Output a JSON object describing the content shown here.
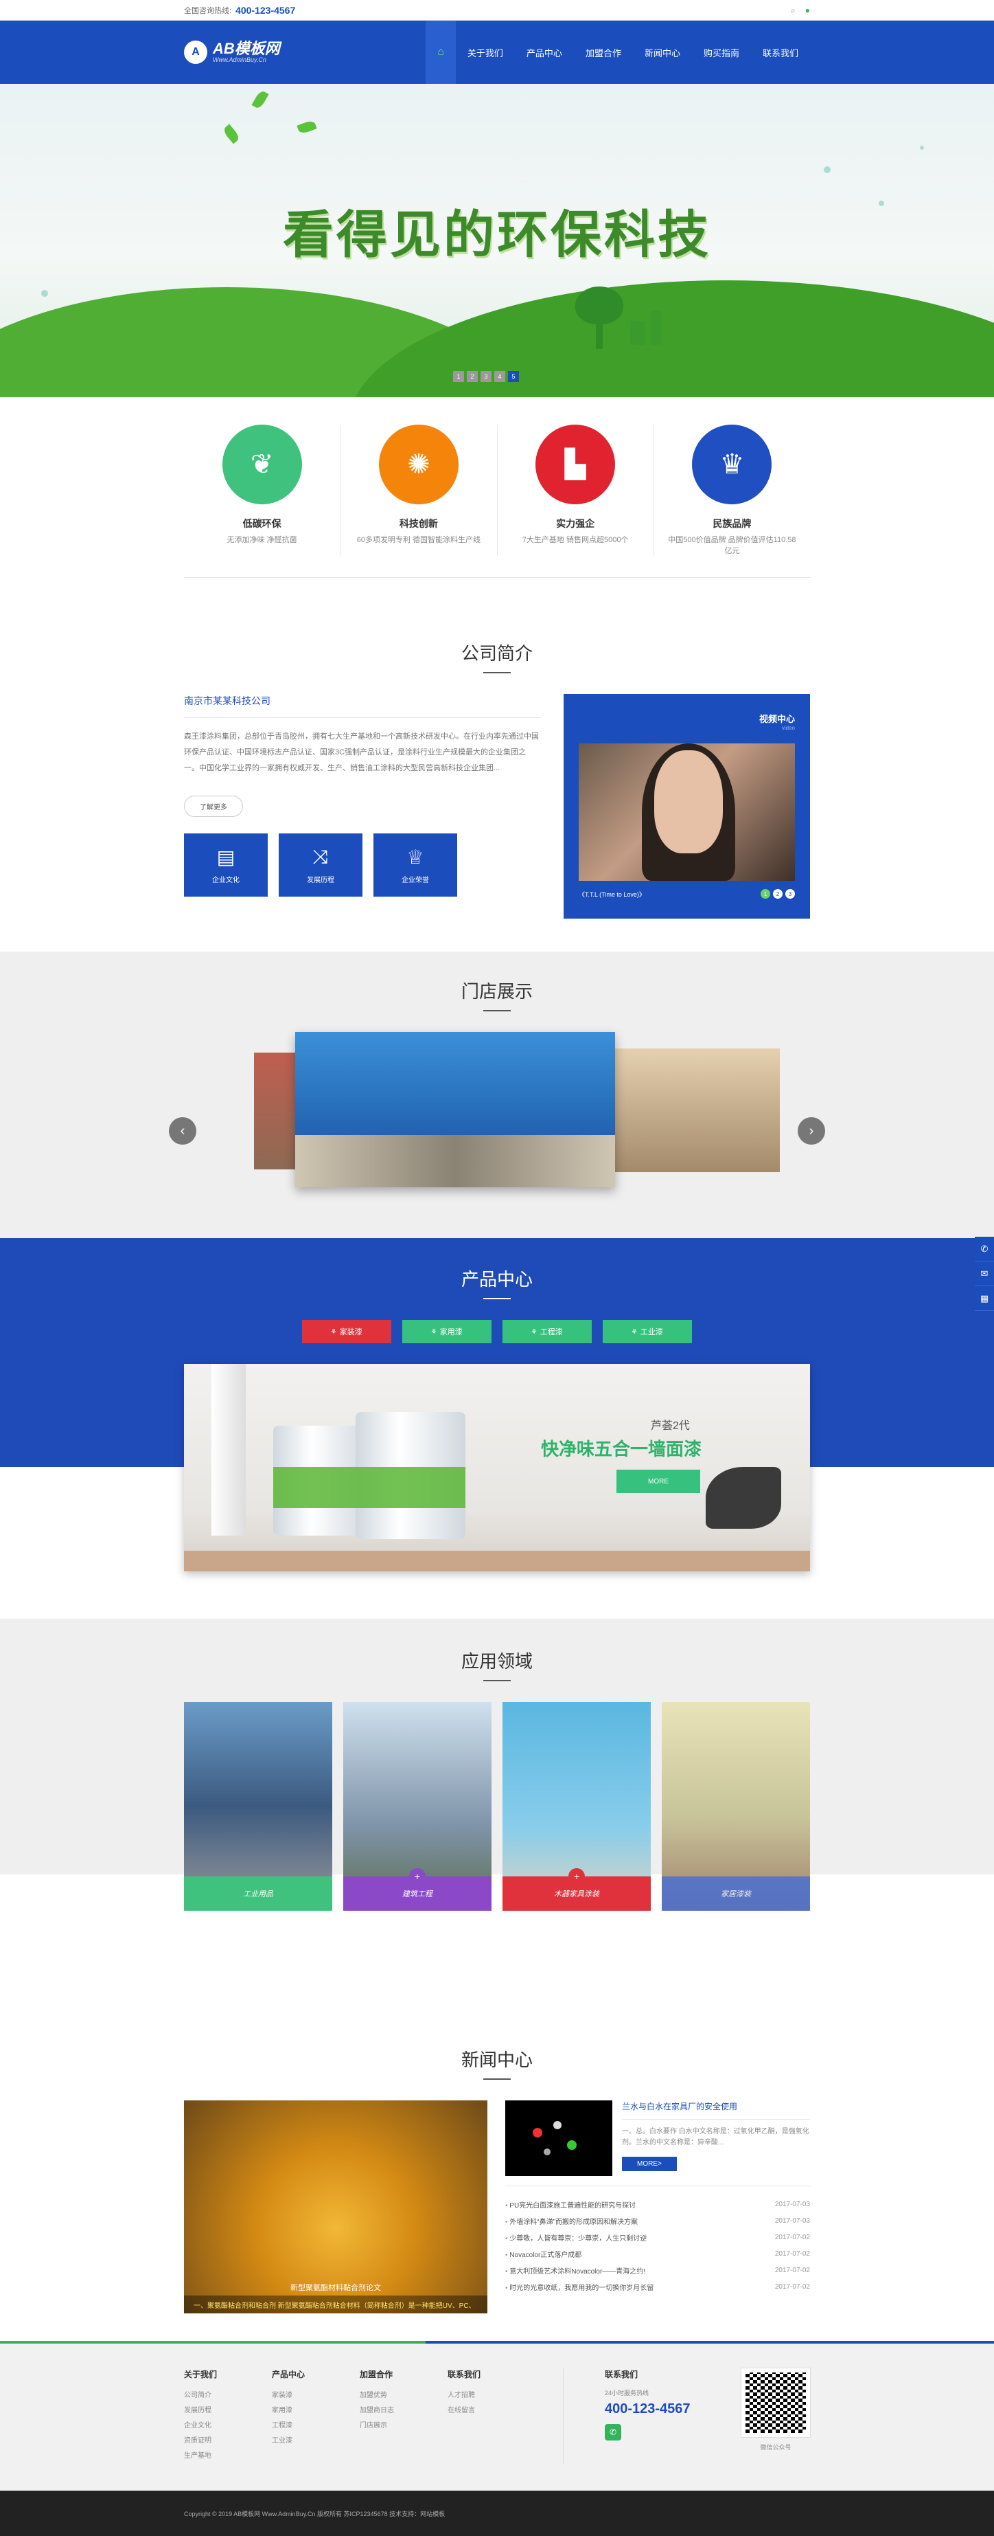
{
  "topbar": {
    "hotline_label": "全国咨询热线:",
    "hotline": "400-123-4567"
  },
  "nav": {
    "logo_title": "AB模板网",
    "logo_sub": "Www.AdminBuy.Cn",
    "items": [
      "首页",
      "关于我们",
      "产品中心",
      "加盟合作",
      "新闻中心",
      "购买指南",
      "联系我们"
    ]
  },
  "banner": {
    "headline": "看得见的环保科技",
    "dots": [
      "1",
      "2",
      "3",
      "4",
      "5"
    ]
  },
  "features": [
    {
      "title": "低碳环保",
      "desc": "无添加净味 净醛抗菌",
      "color": "#3ec27e",
      "icon": "sprout-icon"
    },
    {
      "title": "科技创新",
      "desc": "60多项发明专利 德国智能涂料生产线",
      "color": "#f5840a",
      "icon": "bulb-icon"
    },
    {
      "title": "实力强企",
      "desc": "7大生产基地 销售网点超5000个",
      "color": "#e0232f",
      "icon": "factory-icon"
    },
    {
      "title": "民族品牌",
      "desc": "中国500价值品牌 品牌价值评估110.58亿元",
      "color": "#1f4fc0",
      "icon": "trophy-icon"
    }
  ],
  "about": {
    "title": "公司简介",
    "company": "南京市某某科技公司",
    "text": "森王漆涂料集团，总部位于青岛胶州，拥有七大生产基地和一个高新技术研发中心。在行业内率先通过中国环保产品认证、中国环境标志产品认证、国家3C强制产品认证，是涂料行业生产规模最大的企业集团之一。中国化学工业界的一家拥有权威开发、生产、销售油工涂料的大型民营高新科技企业集团...",
    "more": "了解更多",
    "buttons": [
      {
        "label": "企业文化",
        "icon": "book-icon"
      },
      {
        "label": "发展历程",
        "icon": "shuffle-icon"
      },
      {
        "label": "企业荣誉",
        "icon": "trophy-icon"
      }
    ],
    "video": {
      "title": "视频中心",
      "subtitle": "video",
      "caption": "《T.T.L (Time to Love)》",
      "dots": [
        "1",
        "2",
        "3"
      ]
    }
  },
  "stores": {
    "title": "门店展示"
  },
  "products": {
    "title": "产品中心",
    "tabs": [
      {
        "label": "家装漆",
        "color": "#e0323d"
      },
      {
        "label": "家用漆",
        "color": "#36c27e"
      },
      {
        "label": "工程漆",
        "color": "#36c27e"
      },
      {
        "label": "工业漆",
        "color": "#36c27e"
      }
    ],
    "banner_brand": "芦荟2代",
    "banner_slogan": "快净味五合一墙面漆",
    "banner_more": "MORE"
  },
  "apps": {
    "title": "应用领域",
    "items": [
      {
        "label": "工业用品",
        "color": "#3ec27e"
      },
      {
        "label": "建筑工程",
        "color": "#8b49c8"
      },
      {
        "label": "木器家具涂装",
        "color": "#e0323d"
      },
      {
        "label": "家居漆装",
        "color": "#4b6fd1"
      }
    ]
  },
  "news": {
    "title": "新闻中心",
    "image_caption": "新型聚氨酯材料黏合剂论文",
    "image_desc": "一、聚氨酯粘合剂和粘合剂 新型聚氨酯粘合剂粘合材料（简称粘合剂）是一种能把UV、PC、",
    "featured_title": "兰水与白水在家具厂的安全使用",
    "featured_desc": "一、总。白水要作 白水中文名称是：过氧化甲乙酮，是强氧化剂。兰水的中文名称是：异辛酸...",
    "featured_more": "MORE>",
    "list": [
      {
        "title": "PU亮光白面漆施工普遍性能的研究与探讨",
        "date": "2017-07-03"
      },
      {
        "title": "外墙涂料“鼻涕”而搬的形成原因和解决方案",
        "date": "2017-07-03"
      },
      {
        "title": "少尊敬，人皆有尊崇：少尊崇，人生只剩讨逆",
        "date": "2017-07-02"
      },
      {
        "title": "Novacolor正式落户成都",
        "date": "2017-07-02"
      },
      {
        "title": "意大利顶级艺术涂料Novacolor——青海之约!",
        "date": "2017-07-02"
      },
      {
        "title": "时光的光意收纸，我愿用我的一切换你岁月长留",
        "date": "2017-07-02"
      }
    ]
  },
  "footer": {
    "cols": [
      {
        "title": "关于我们",
        "items": [
          "公司简介",
          "发展历程",
          "企业文化",
          "资质证明",
          "生产基地"
        ]
      },
      {
        "title": "产品中心",
        "items": [
          "家装漆",
          "家用漆",
          "工程漆",
          "工业漆"
        ]
      },
      {
        "title": "加盟合作",
        "items": [
          "加盟优势",
          "加盟商日志",
          "门店展示"
        ]
      },
      {
        "title": "联系我们",
        "items": [
          "人才招聘",
          "在线留言"
        ]
      }
    ],
    "contact_title": "联系我们",
    "hours": "24小时服务热线",
    "tel": "400-123-4567",
    "qr_label": "微信公众号",
    "copyright": "Copyright © 2019 AB模板网 Www.AdminBuy.Cn 版权所有   苏ICP12345678   技术支持：网站模板"
  }
}
